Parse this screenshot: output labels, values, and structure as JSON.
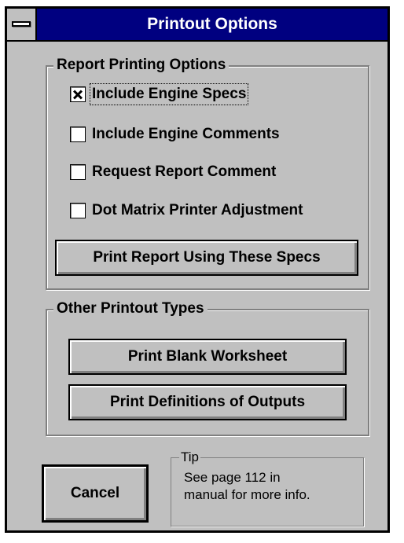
{
  "window": {
    "title": "Printout Options"
  },
  "report_group": {
    "legend": "Report Printing Options",
    "options": [
      {
        "label": "Include Engine Specs",
        "checked": true
      },
      {
        "label": "Include Engine Comments",
        "checked": false
      },
      {
        "label": "Request Report Comment",
        "checked": false
      },
      {
        "label": "Dot Matrix Printer Adjustment",
        "checked": false
      }
    ],
    "print_button": "Print Report Using These Specs"
  },
  "other_group": {
    "legend": "Other Printout Types",
    "blank_button": "Print Blank Worksheet",
    "definitions_button": "Print Definitions of Outputs"
  },
  "cancel_button": "Cancel",
  "tip": {
    "legend": "Tip",
    "line1": "See page 112 in",
    "line2": "manual for more info."
  }
}
